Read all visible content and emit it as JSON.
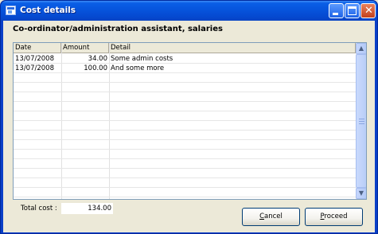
{
  "window": {
    "title": "Cost details"
  },
  "heading": "Co-ordinator/administration assistant, salaries",
  "grid": {
    "columns": [
      "Date",
      "Amount",
      "Detail"
    ],
    "rows": [
      {
        "date": "13/07/2008",
        "amount": "34.00",
        "detail": "Some admin costs"
      },
      {
        "date": "13/07/2008",
        "amount": "100.00",
        "detail": "And some more"
      }
    ]
  },
  "total": {
    "label": "Total cost :",
    "value": "134.00"
  },
  "buttons": {
    "cancel_accel": "C",
    "cancel_rest": "ancel",
    "proceed_accel": "P",
    "proceed_rest": "roceed"
  }
}
